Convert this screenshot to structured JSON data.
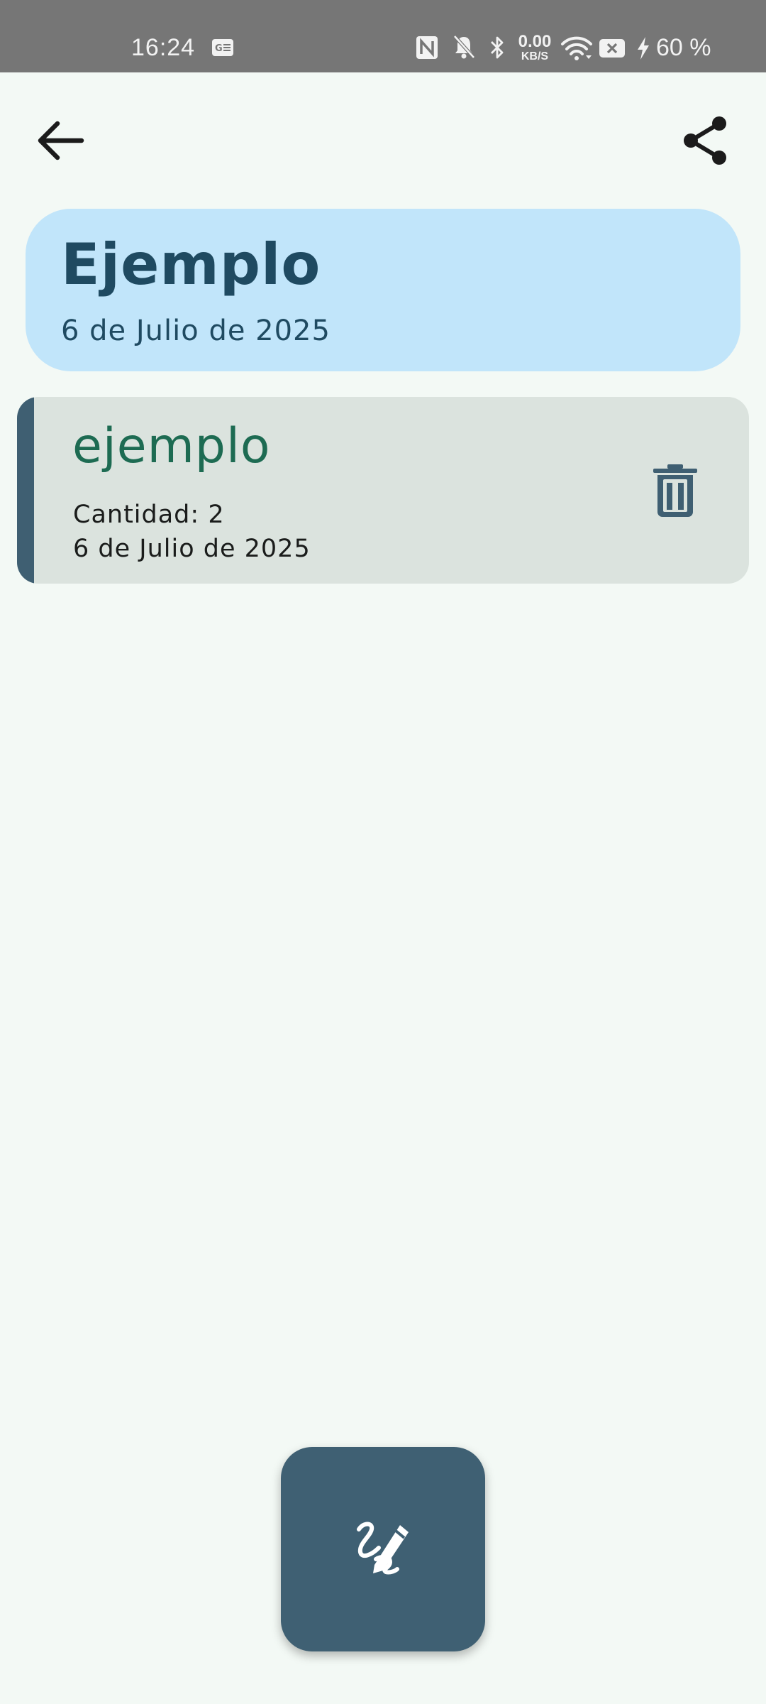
{
  "status_bar": {
    "time": "16:24",
    "net_speed_value": "0.00",
    "net_speed_unit": "KB/S",
    "battery": "60 %",
    "icons": [
      "translate-icon",
      "nfc-icon",
      "bell-off-icon",
      "bluetooth-icon",
      "wifi-icon",
      "sim-disabled-icon",
      "charging-icon"
    ]
  },
  "app_bar": {
    "back_icon": "arrow-back-icon",
    "share_icon": "share-icon"
  },
  "header": {
    "title": "Ejemplo",
    "date": "6 de Julio de 2025",
    "background": "#c1e5fa",
    "text_color": "#1f4a61"
  },
  "items": [
    {
      "name": "ejemplo",
      "quantity": "Cantidad: 2",
      "date": "6 de Julio de 2025",
      "delete_icon": "trash-icon"
    }
  ],
  "fab": {
    "icon": "draw-icon",
    "color": "#3f6073"
  },
  "colors": {
    "page_background": "#f3f9f5",
    "item_background": "#dbe3de",
    "item_accent": "#3f5f72",
    "item_title": "#1d6b52"
  }
}
